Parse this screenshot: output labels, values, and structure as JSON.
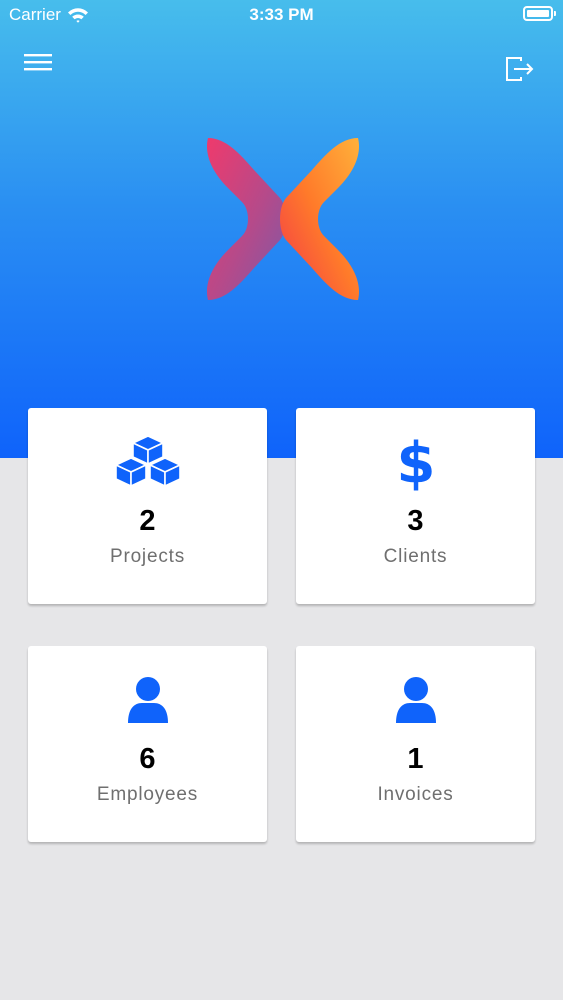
{
  "status_bar": {
    "carrier": "Carrier",
    "time": "3:33 PM"
  },
  "header": {
    "menu_icon": "hamburger-menu-icon",
    "logout_icon": "logout-icon"
  },
  "logo": {
    "icon": "app-logo-x"
  },
  "colors": {
    "gradient_top": "#47bdec",
    "gradient_bottom": "#0f63fb",
    "icon_blue": "#0f63fb",
    "background": "#e6e6e8"
  },
  "dashboard": {
    "cards": [
      {
        "label": "Projects",
        "count": "2",
        "icon": "cubes-icon"
      },
      {
        "label": "Clients",
        "count": "3",
        "icon": "dollar-icon"
      },
      {
        "label": "Employees",
        "count": "6",
        "icon": "user-icon"
      },
      {
        "label": "Invoices",
        "count": "1",
        "icon": "user-icon"
      }
    ]
  }
}
